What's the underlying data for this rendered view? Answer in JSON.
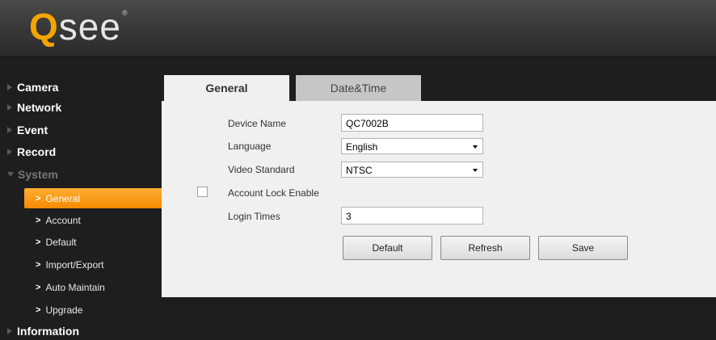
{
  "brand": {
    "logo_q": "Q",
    "logo_rest": "see",
    "logo_mark": "®"
  },
  "sidebar": {
    "top_items": [
      {
        "label": "Camera"
      },
      {
        "label": "Network"
      },
      {
        "label": "Event"
      },
      {
        "label": "Record"
      },
      {
        "label": "System"
      },
      {
        "label": "Information"
      }
    ],
    "system_items": [
      {
        "label": "General",
        "active": true
      },
      {
        "label": "Account"
      },
      {
        "label": "Default"
      },
      {
        "label": "Import/Export"
      },
      {
        "label": "Auto Maintain"
      },
      {
        "label": "Upgrade"
      }
    ],
    "chevron": ">"
  },
  "tabs": [
    {
      "label": "General",
      "active": true
    },
    {
      "label": "Date&Time",
      "active": false
    }
  ],
  "form": {
    "device_name": {
      "label": "Device Name",
      "value": "QC7002B"
    },
    "language": {
      "label": "Language",
      "value": "English"
    },
    "video_standard": {
      "label": "Video Standard",
      "value": "NTSC"
    },
    "account_lock": {
      "label": "Account Lock Enable",
      "checked": false
    },
    "login_times": {
      "label": "Login Times",
      "value": "3"
    }
  },
  "buttons": {
    "default": "Default",
    "refresh": "Refresh",
    "save": "Save"
  },
  "colors": {
    "accent": "#f58a00",
    "logo_q": "#f5a500",
    "panel_bg": "#f0f0f0",
    "sidebar_bg": "#1e1e1e"
  }
}
